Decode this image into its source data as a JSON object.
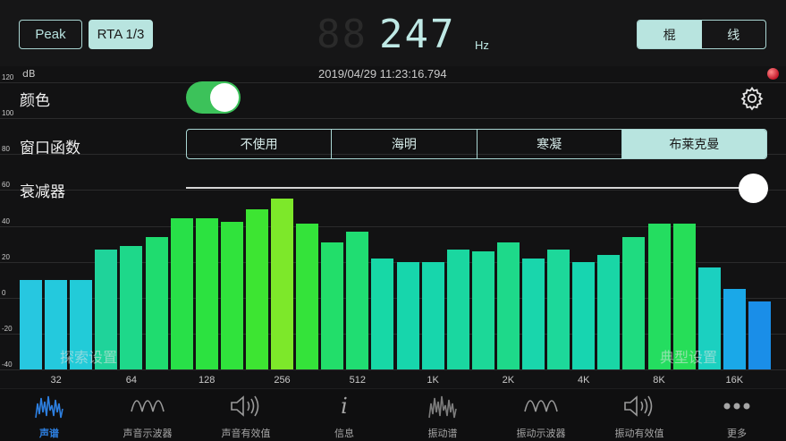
{
  "header": {
    "peak_label": "Peak",
    "rta_label": "RTA 1/3",
    "freq_ghost": "88",
    "freq_value": "247",
    "freq_unit": "Hz",
    "view_options": [
      "棍",
      "线"
    ],
    "active_view": "棍"
  },
  "chart": {
    "db_label": "dB",
    "timestamp": "2019/04/29 11:23:16.794",
    "y_ticks": [
      "120",
      "100",
      "80",
      "60",
      "40",
      "20",
      "0",
      "-20",
      "-40"
    ],
    "x_ticks": [
      "32",
      "64",
      "128",
      "256",
      "512",
      "1K",
      "2K",
      "4K",
      "8K",
      "16K"
    ],
    "left_overlay": "探索设置",
    "right_overlay": "典型设置"
  },
  "chart_data": {
    "type": "bar",
    "ylabel": "dB",
    "ylim": [
      -40,
      120
    ],
    "values": [
      10,
      10,
      10,
      27,
      29,
      34,
      44,
      44,
      42,
      49,
      55,
      41,
      31,
      37,
      22,
      20,
      20,
      27,
      26,
      31,
      22,
      27,
      20,
      24,
      34,
      41,
      41,
      17,
      5,
      -2
    ],
    "x_tick_labels": [
      "32",
      "64",
      "128",
      "256",
      "512",
      "1K",
      "2K",
      "4K",
      "8K",
      "16K"
    ]
  },
  "settings": {
    "color_label": "颜色",
    "color_enabled": true,
    "window_label": "窗口函数",
    "window_options": [
      "不使用",
      "海明",
      "寒凝",
      "布莱克曼"
    ],
    "window_active": "布莱克曼",
    "attenuator_label": "衰减器",
    "attenuator_level": 1.0
  },
  "tabs": [
    {
      "label": "声谱",
      "icon": "spectrum-icon",
      "active": true
    },
    {
      "label": "声音示波器",
      "icon": "wave-icon",
      "active": false
    },
    {
      "label": "声音有效值",
      "icon": "speaker-icon",
      "active": false
    },
    {
      "label": "信息",
      "icon": "info-icon",
      "active": false
    },
    {
      "label": "振动谱",
      "icon": "vibration-spectrum-icon",
      "active": false
    },
    {
      "label": "振动示波器",
      "icon": "wave-icon",
      "active": false
    },
    {
      "label": "振动有效值",
      "icon": "speaker-icon",
      "active": false
    },
    {
      "label": "更多",
      "icon": "more-icon",
      "active": false
    }
  ],
  "colors": {
    "accent": "#b8e4df",
    "active_tab": "#2d7fe0",
    "switch_on": "#3cc25a"
  }
}
